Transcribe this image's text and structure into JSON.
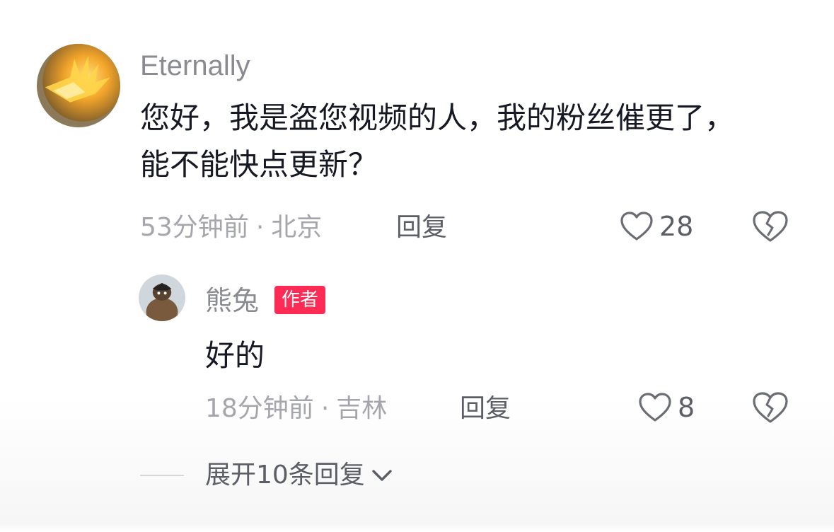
{
  "comment": {
    "username": "Eternally",
    "text_lines": [
      "您好，我是盗您视频的人，我的粉丝催更了，",
      "能不能快点更新？"
    ],
    "time": "53分钟前",
    "location": "北京",
    "separator": "·",
    "reply_label": "回复",
    "likes": "28",
    "avatar_icon": "flame-hand-avatar-icon"
  },
  "reply": {
    "username": "熊兔",
    "badge": "作者",
    "text": "好的",
    "time": "18分钟前",
    "location": "吉林",
    "separator": "·",
    "reply_label": "回复",
    "likes": "8",
    "avatar_icon": "character-avatar-icon"
  },
  "expand": {
    "label": "展开10条回复",
    "icon": "chevron-down-icon"
  },
  "colors": {
    "accent_badge": "#fe2c55",
    "text_primary": "#161823",
    "text_secondary": "#8a8b91",
    "meta": "#a5a6ab"
  }
}
